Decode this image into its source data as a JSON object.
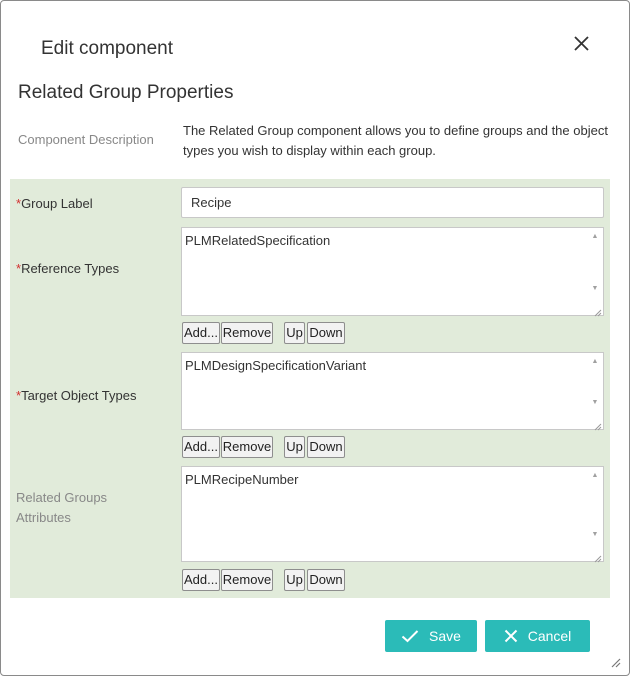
{
  "dialog": {
    "title": "Edit component",
    "close_icon": "close-icon"
  },
  "section_title": "Related Group Properties",
  "description": {
    "label": "Component Description",
    "text": "The Related Group component allows you to define groups and the object types you wish to display within each group."
  },
  "fields": {
    "required_mark": "*",
    "group_label": {
      "label": "Group Label",
      "value": "Recipe"
    },
    "reference_types": {
      "label": "Reference Types",
      "items": [
        "PLMRelatedSpecification"
      ]
    },
    "target_object_types": {
      "label": "Target Object Types",
      "items": [
        "PLMDesignSpecificationVariant"
      ]
    },
    "related_groups_attributes": {
      "label_line1": "Related Groups",
      "label_line2": "Attributes",
      "items": [
        "PLMRecipeNumber"
      ]
    }
  },
  "list_buttons": {
    "add": "Add...",
    "remove": "Remove",
    "up": "Up",
    "down": "Down"
  },
  "footer": {
    "save": "Save",
    "cancel": "Cancel"
  },
  "colors": {
    "accent": "#2bbbb8",
    "panel_background": "#e1ebda",
    "required": "#d23030"
  }
}
